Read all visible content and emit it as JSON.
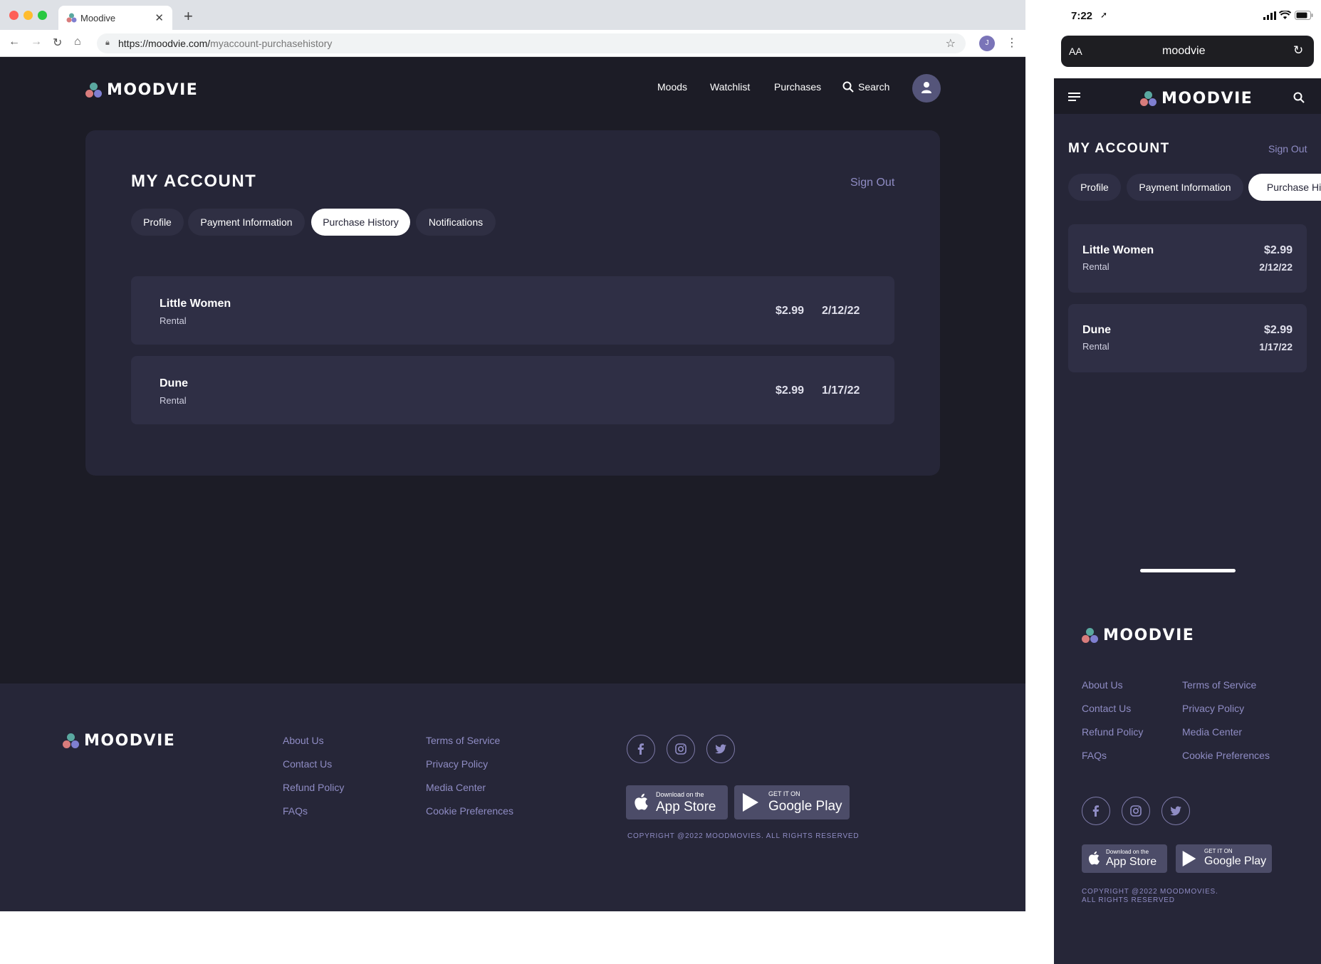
{
  "browser": {
    "tab_title": "Moodive",
    "url_host": "https://moodvie.com/",
    "url_path": "myaccount-purchasehistory",
    "profile_initial": "J"
  },
  "brand": {
    "name": "MOODVIE",
    "dot_colors": [
      "#5aa8a0",
      "#d87c7c",
      "#7f7fd0"
    ]
  },
  "nav": {
    "moods": "Moods",
    "watchlist": "Watchlist",
    "purchases": "Purchases",
    "search": "Search"
  },
  "account": {
    "title": "MY ACCOUNT",
    "sign_out": "Sign Out",
    "tabs": [
      "Profile",
      "Payment Information",
      "Purchase History",
      "Notifications"
    ],
    "mobile_tab_truncated": "Purchase Hist",
    "active_tab": "Purchase History"
  },
  "purchases": [
    {
      "title": "Little Women",
      "type": "Rental",
      "price": "$2.99",
      "date": "2/12/22"
    },
    {
      "title": "Dune",
      "type": "Rental",
      "price": "$2.99",
      "date": "1/17/22"
    }
  ],
  "footer": {
    "links_col1": [
      "About Us",
      "Contact Us",
      "Refund Policy",
      "FAQs"
    ],
    "links_col2": [
      "Terms of Service",
      "Privacy Policy",
      "Media Center",
      "Cookie Preferences"
    ],
    "social": [
      "facebook-icon",
      "instagram-icon",
      "twitter-icon"
    ],
    "app_store_small": "Download on the",
    "app_store_big": "App Store",
    "google_play_small": "GET IT ON",
    "google_play_big": "Google Play",
    "copyright": "COPYRIGHT @2022 MOODMOVIES. ALL RIGHTS RESERVED",
    "copyright_line1": "COPYRIGHT @2022 MOODMOVIES.",
    "copyright_line2": "ALL RIGHTS RESERVED"
  },
  "mobile": {
    "time": "7:22",
    "address": "moodvie",
    "text_size": "AA"
  },
  "colors": {
    "bg": "#1c1c26",
    "card": "#262638",
    "accent": "#8f8cc4"
  }
}
